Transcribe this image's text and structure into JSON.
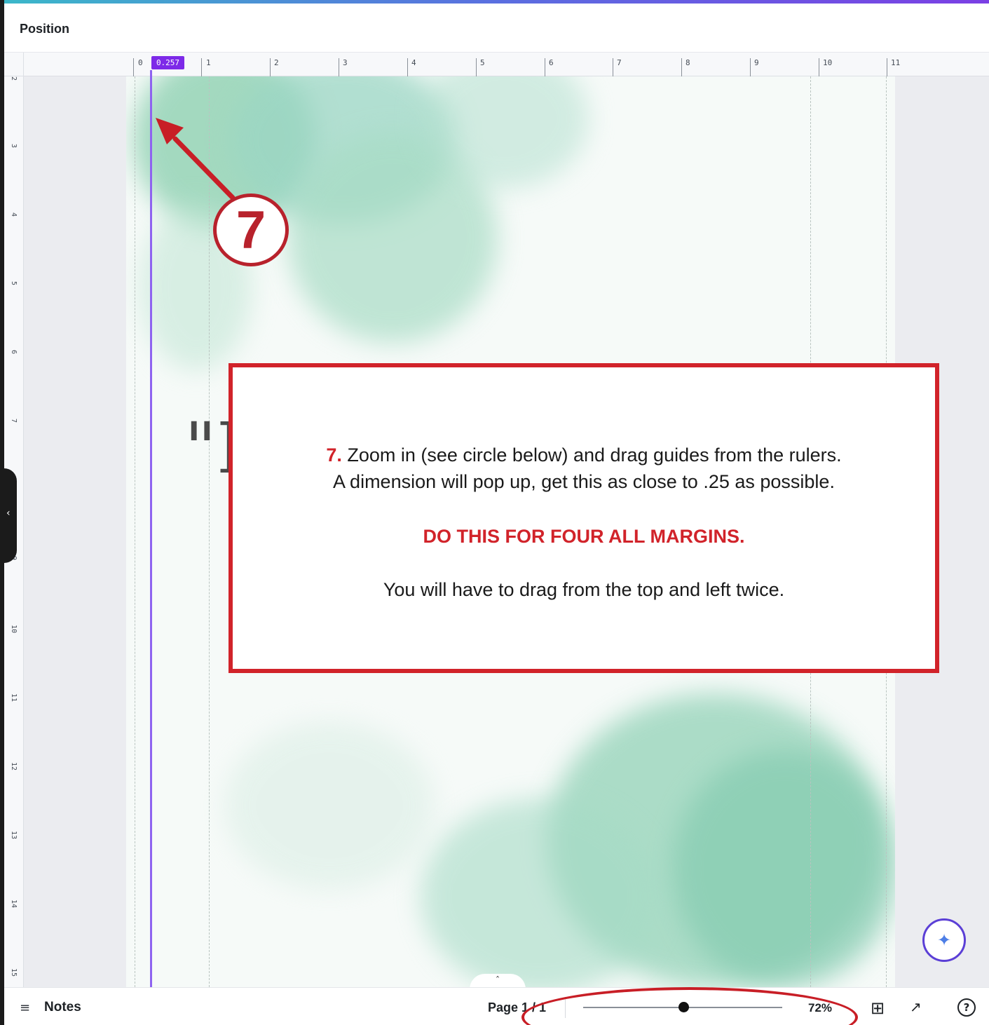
{
  "header": {
    "title": "Position"
  },
  "ruler": {
    "top_numbers": [
      "0",
      "1",
      "2",
      "3",
      "4",
      "5",
      "6",
      "7",
      "8",
      "9",
      "10",
      "11"
    ],
    "left_numbers": [
      "2",
      "3",
      "4",
      "5",
      "6",
      "7",
      "8",
      "9",
      "10",
      "11",
      "12",
      "13",
      "14",
      "15"
    ],
    "guide_value": "0.257"
  },
  "canvas": {
    "quote_fragment": "\"F"
  },
  "annotation": {
    "step_number": "7",
    "step_prefix": "7.",
    "line1": "Zoom in (see circle below) and drag guides from the rulers.",
    "line2": "A dimension will pop up, get this as close to .25 as possible.",
    "emphasis": "DO THIS FOR FOUR ALL MARGINS.",
    "line3": "You will have to drag from the top and left twice.",
    "accent_color": "#d1232a"
  },
  "footer": {
    "notes_label": "Notes",
    "page_label": "Page 1 / 1",
    "zoom_value": "72%",
    "zoom_level": 0.72,
    "icons": [
      "notes-icon",
      "grid-view-icon",
      "fullscreen-icon",
      "help-icon",
      "magic-sparkle-icon"
    ]
  },
  "colors": {
    "guide": "#8e63f0",
    "badge": "#7d2ae8",
    "watercolor": "#8fd1b2"
  }
}
